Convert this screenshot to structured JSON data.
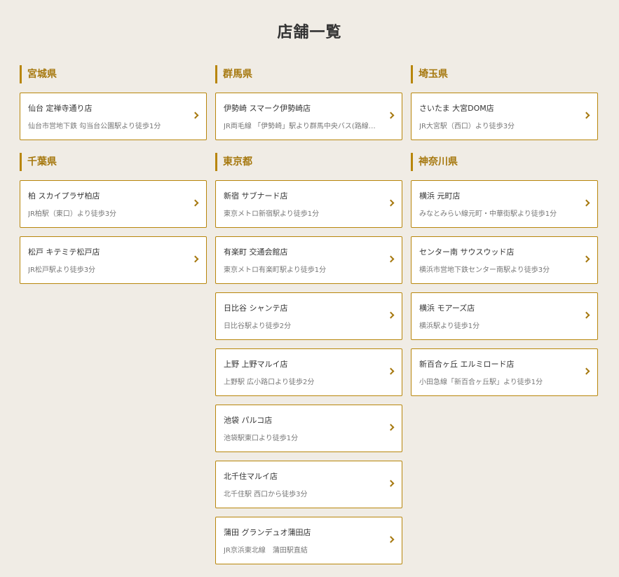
{
  "page": {
    "title": "店舗一覧"
  },
  "colors": {
    "background": "#f0ece5",
    "accent": "#b8860b",
    "heading_text": "#a6780e",
    "card_background": "#ffffff"
  },
  "columns": [
    {
      "regions": [
        {
          "name": "宮城県",
          "stores": [
            {
              "name": "仙台 定禅寺通り店",
              "access": "仙台市営地下鉄 勾当台公園駅より徒歩1分"
            }
          ]
        },
        {
          "name": "千葉県",
          "stores": [
            {
              "name": "柏 スカイプラザ柏店",
              "access": "JR柏駅（東口）より徒歩3分"
            },
            {
              "name": "松戸 キテミテ松戸店",
              "access": "JR松戸駅より徒歩3分"
            }
          ]
        }
      ]
    },
    {
      "regions": [
        {
          "name": "群馬県",
          "stores": [
            {
              "name": "伊勢崎 スマーク伊勢崎店",
              "access": "JR両毛線 「伊勢崎」駅より群馬中央バス(路線…"
            }
          ]
        },
        {
          "name": "東京都",
          "stores": [
            {
              "name": "新宿 サブナード店",
              "access": "東京メトロ新宿駅より徒歩1分"
            },
            {
              "name": "有楽町 交通会館店",
              "access": "東京メトロ有楽町駅より徒歩1分"
            },
            {
              "name": "日比谷 シャンテ店",
              "access": "日比谷駅より徒歩2分"
            },
            {
              "name": "上野 上野マルイ店",
              "access": "上野駅 広小路口より徒歩2分"
            },
            {
              "name": "池袋 パルコ店",
              "access": "池袋駅東口より徒歩1分"
            },
            {
              "name": "北千住マルイ店",
              "access": "北千住駅 西口から徒歩3分"
            },
            {
              "name": "蒲田 グランデュオ蒲田店",
              "access": "JR京浜東北線　蒲田駅直結"
            }
          ]
        }
      ]
    },
    {
      "regions": [
        {
          "name": "埼玉県",
          "stores": [
            {
              "name": "さいたま 大宮DOM店",
              "access": "JR大宮駅（西口）より徒歩3分"
            }
          ]
        },
        {
          "name": "神奈川県",
          "stores": [
            {
              "name": "横浜 元町店",
              "access": "みなとみらい線元町・中華街駅より徒歩1分"
            },
            {
              "name": "センター南 サウスウッド店",
              "access": "横浜市営地下鉄センター南駅より徒歩3分"
            },
            {
              "name": "横浜 モアーズ店",
              "access": "横浜駅より徒歩1分"
            },
            {
              "name": "新百合ヶ丘 エルミロード店",
              "access": "小田急線「新百合ヶ丘駅」より徒歩1分"
            }
          ]
        }
      ]
    }
  ]
}
